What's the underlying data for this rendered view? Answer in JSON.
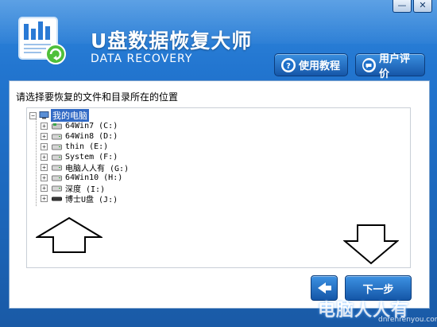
{
  "window": {
    "minimize_label": "—",
    "close_label": "✕"
  },
  "header": {
    "title": "U盘数据恢复大师",
    "subtitle": "DATA RECOVERY",
    "help_button": "使用教程",
    "review_button": "用户评价"
  },
  "main": {
    "prompt": "请选择要恢复的文件和目录所在的位置",
    "tree": {
      "root_label": "我的电脑",
      "items": [
        {
          "label": "64Win7  (C:)"
        },
        {
          "label": "64Win8  (D:)"
        },
        {
          "label": "thin (E:)"
        },
        {
          "label": "System (F:)"
        },
        {
          "label": "电脑人人有 (G:)"
        },
        {
          "label": "64Win10 (H:)"
        },
        {
          "label": "深度 (I:)"
        },
        {
          "label": "博士U盘 (J:)"
        }
      ]
    }
  },
  "footer": {
    "next_label": "下一步",
    "watermark": "电脑人人有",
    "watermark_sub": "dnrenrenyou.com"
  },
  "colors": {
    "accent": "#1c68bd",
    "selection": "#316ac5"
  }
}
